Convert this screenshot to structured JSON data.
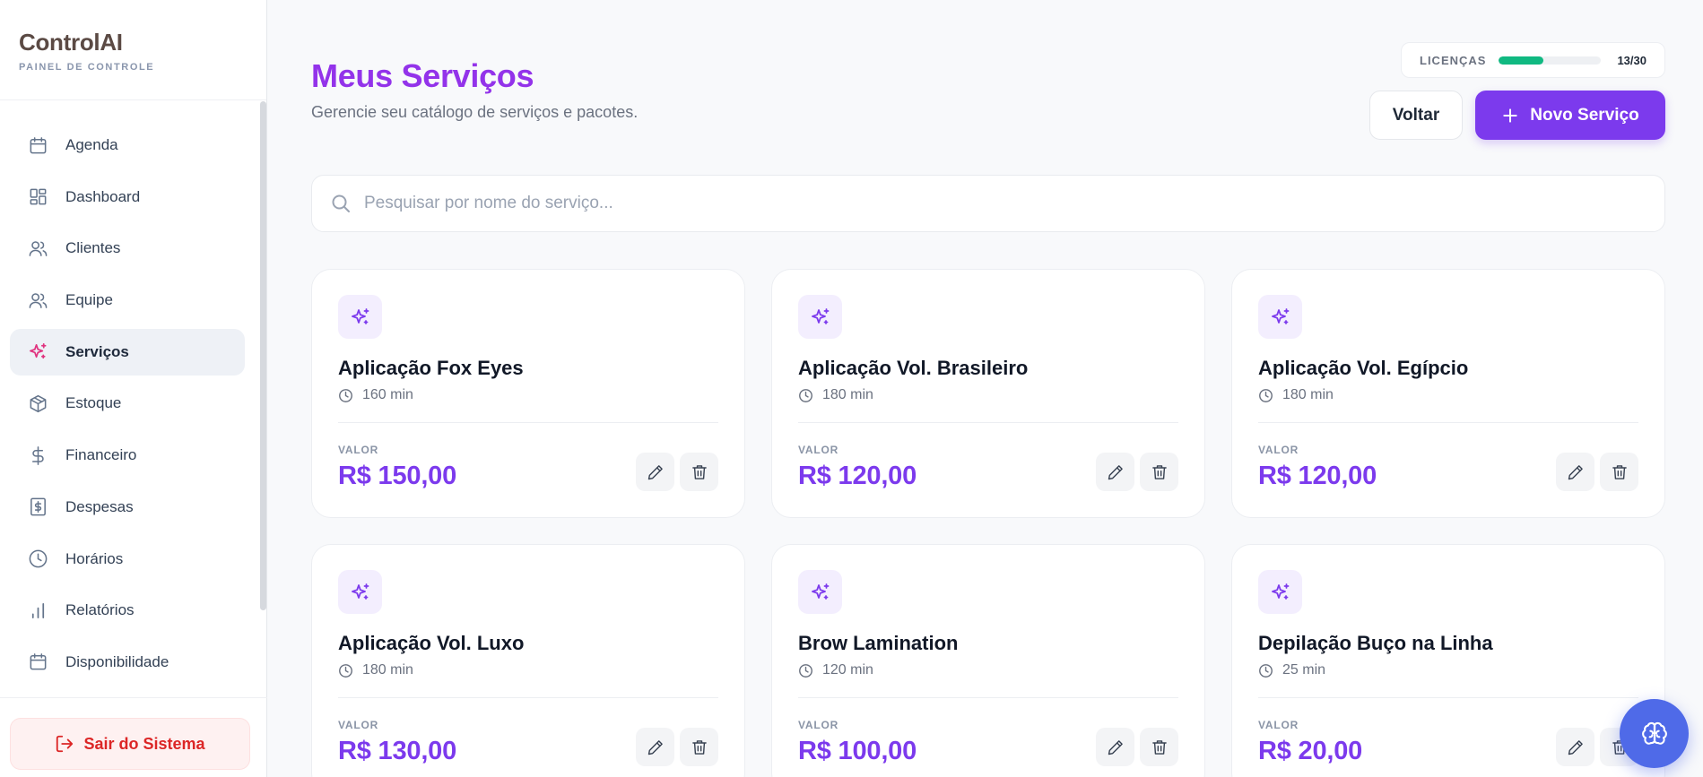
{
  "app": {
    "brand": "ControlAI",
    "brand_sub": "PAINEL DE CONTROLE"
  },
  "sidebar": {
    "items": [
      {
        "label": "Agenda",
        "icon": "calendar-icon",
        "active": false
      },
      {
        "label": "Dashboard",
        "icon": "dashboard-grid-icon",
        "active": false
      },
      {
        "label": "Clientes",
        "icon": "users-icon",
        "active": false
      },
      {
        "label": "Equipe",
        "icon": "team-icon",
        "active": false
      },
      {
        "label": "Serviços",
        "icon": "sparkles-icon",
        "active": true
      },
      {
        "label": "Estoque",
        "icon": "package-icon",
        "active": false
      },
      {
        "label": "Financeiro",
        "icon": "dollar-icon",
        "active": false
      },
      {
        "label": "Despesas",
        "icon": "receipt-icon",
        "active": false
      },
      {
        "label": "Horários",
        "icon": "clock-icon",
        "active": false
      },
      {
        "label": "Relatórios",
        "icon": "bar-chart-icon",
        "active": false
      },
      {
        "label": "Disponibilidade",
        "icon": "calendar-icon",
        "active": false
      }
    ],
    "logout_label": "Sair do Sistema"
  },
  "header": {
    "title": "Meus Serviços",
    "subtitle": "Gerencie seu catálogo de serviços e pacotes.",
    "license_label": "LICENÇAS",
    "license_used": 13,
    "license_total": 30,
    "license_count": "13/30",
    "back_label": "Voltar",
    "new_label": "Novo Serviço"
  },
  "search": {
    "placeholder": "Pesquisar por nome do serviço...",
    "value": ""
  },
  "colors": {
    "accent": "#7c3aed",
    "title": "#9333ea",
    "license_bar": "#10b981",
    "logout": "#dc2626",
    "fab": "#4f6ae8"
  },
  "services": [
    {
      "name": "Aplicação Fox Eyes",
      "duration": "160 min",
      "value_label": "VALOR",
      "price": "R$ 150,00"
    },
    {
      "name": "Aplicação Vol. Brasileiro",
      "duration": "180 min",
      "value_label": "VALOR",
      "price": "R$ 120,00"
    },
    {
      "name": "Aplicação Vol. Egípcio",
      "duration": "180 min",
      "value_label": "VALOR",
      "price": "R$ 120,00"
    },
    {
      "name": "Aplicação Vol. Luxo",
      "duration": "180 min",
      "value_label": "VALOR",
      "price": "R$ 130,00"
    },
    {
      "name": "Brow Lamination",
      "duration": "120 min",
      "value_label": "VALOR",
      "price": "R$ 100,00"
    },
    {
      "name": "Depilação Buço na Linha",
      "duration": "25 min",
      "value_label": "VALOR",
      "price": "R$ 20,00"
    }
  ]
}
